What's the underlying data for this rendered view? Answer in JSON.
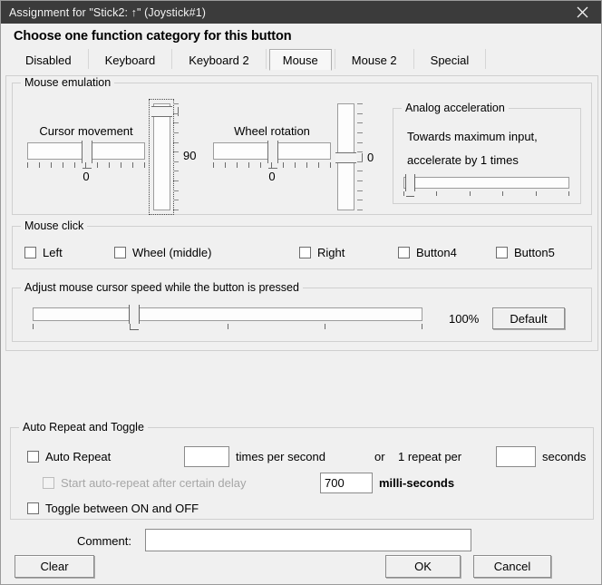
{
  "titlebar": {
    "title": "Assignment for \"Stick2: ↑\" (Joystick#1)",
    "close_label": "✕"
  },
  "heading": "Choose one function category for this button",
  "tabs": [
    {
      "label": "Disabled",
      "selected": false
    },
    {
      "label": "Keyboard",
      "selected": false
    },
    {
      "label": "Keyboard 2",
      "selected": false
    },
    {
      "label": "Mouse",
      "selected": true
    },
    {
      "label": "Mouse 2",
      "selected": false
    },
    {
      "label": "Special",
      "selected": false
    }
  ],
  "mouse_emulation": {
    "legend": "Mouse emulation",
    "cursor_movement": {
      "caption": "Cursor movement",
      "value": "0"
    },
    "cursor_vertical": {
      "value": "90"
    },
    "wheel_rotation": {
      "caption": "Wheel rotation",
      "value": "0"
    },
    "wheel_vertical": {
      "value": "0"
    },
    "analog_acceleration": {
      "legend": "Analog acceleration",
      "line1": "Towards maximum input,",
      "line2": "accelerate by 1 times"
    }
  },
  "mouse_click": {
    "legend": "Mouse click",
    "items": [
      {
        "label": "Left",
        "checked": false
      },
      {
        "label": "Wheel (middle)",
        "checked": false
      },
      {
        "label": "Right",
        "checked": false
      },
      {
        "label": "Button4",
        "checked": false
      },
      {
        "label": "Button5",
        "checked": false
      }
    ]
  },
  "cursor_speed": {
    "legend": "Adjust mouse cursor speed while the button is pressed",
    "percent": "100%",
    "default_button": "Default"
  },
  "auto_repeat": {
    "legend": "Auto Repeat and Toggle",
    "auto_repeat_label": "Auto Repeat",
    "auto_repeat_checked": false,
    "rate_value": "",
    "times_per_second_label": "times per second",
    "or_label": "or",
    "one_repeat_per_label": "1 repeat per",
    "seconds_value": "",
    "seconds_label": "seconds",
    "delay_label": "Start auto-repeat after certain delay",
    "delay_checked": false,
    "delay_disabled": true,
    "delay_value": "700",
    "milliseconds_label": "milli-seconds",
    "toggle_label": "Toggle between ON and OFF",
    "toggle_checked": false
  },
  "footer": {
    "comment_label": "Comment:",
    "comment_value": "",
    "clear_button": "Clear",
    "ok_button": "OK",
    "cancel_button": "Cancel"
  }
}
